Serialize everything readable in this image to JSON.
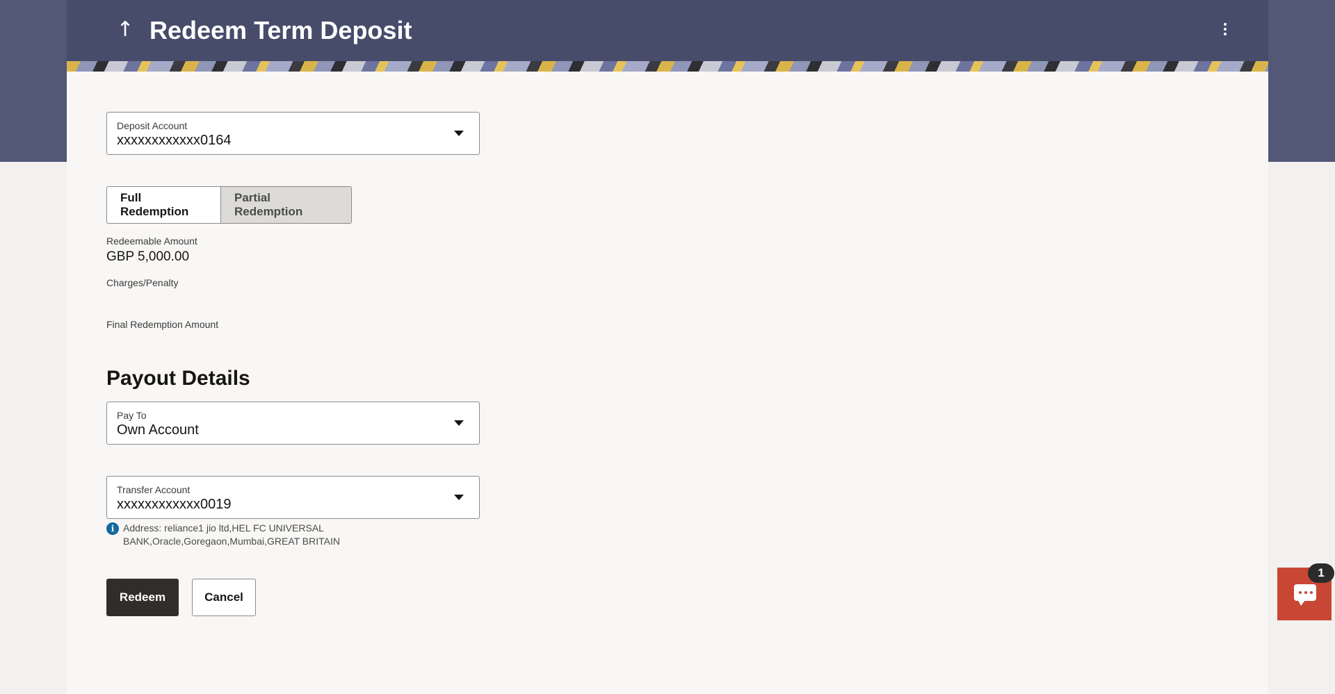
{
  "header": {
    "title": "Redeem Term Deposit",
    "back_icon": "arrow-up-icon",
    "menu_icon": "kebab-menu-icon"
  },
  "deposit_account": {
    "label": "Deposit Account",
    "value": "xxxxxxxxxxxx0164"
  },
  "redemption_toggle": {
    "options": [
      "Full Redemption",
      "Partial Redemption"
    ],
    "selected": "Full Redemption"
  },
  "summary": {
    "redeemable_label": "Redeemable Amount",
    "redeemable_value": "GBP 5,000.00",
    "charges_label": "Charges/Penalty",
    "final_label": "Final Redemption Amount"
  },
  "payout": {
    "section_title": "Payout Details",
    "pay_to_label": "Pay To",
    "pay_to_value": "Own Account",
    "transfer_label": "Transfer Account",
    "transfer_value": "xxxxxxxxxxxx0019",
    "address_text": "Address: reliance1 jio ltd,HEL FC UNIVERSAL BANK,Oracle,Goregaon,Mumbai,GREAT BRITAIN"
  },
  "actions": {
    "redeem_label": "Redeem",
    "cancel_label": "Cancel"
  },
  "chat": {
    "badge_count": "1",
    "icon": "chat-icon"
  },
  "colors": {
    "header_bg": "#474c6b",
    "primary_button": "#312d2a",
    "chat_widget": "#c74634",
    "info_icon": "#116aa0"
  }
}
